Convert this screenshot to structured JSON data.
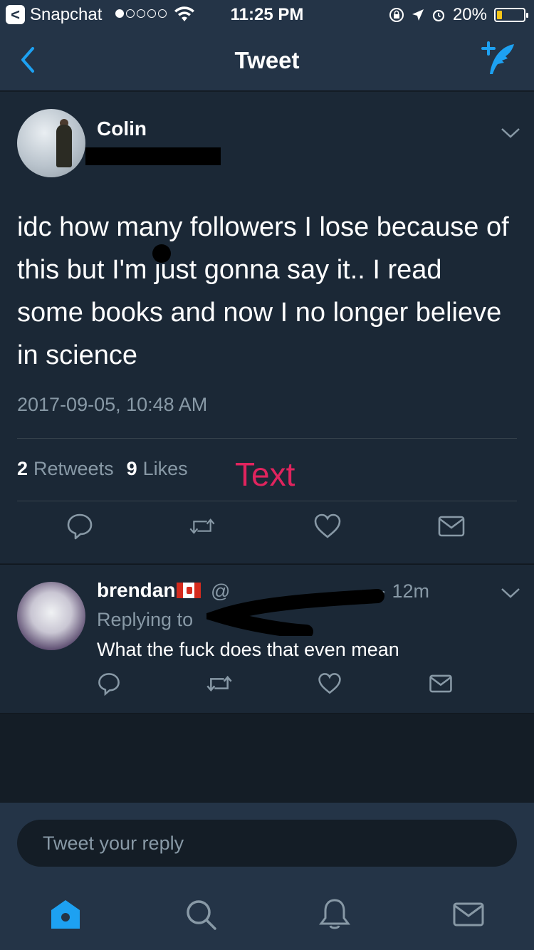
{
  "status_bar": {
    "back_label": "<",
    "app_name": "Snapchat",
    "time": "11:25 PM",
    "battery": "20%",
    "battery_level": 0.2
  },
  "nav": {
    "title": "Tweet"
  },
  "main_tweet": {
    "author_name": "Colin",
    "text": "idc how many followers I lose because of this but I'm just gonna say it.. I read some books and now I no longer believe in science",
    "timestamp": "2017-09-05, 10:48 AM",
    "retweets_count": "2",
    "retweets_label": "Retweets",
    "likes_count": "9",
    "likes_label": "Likes",
    "overlay_text": "Text"
  },
  "reply": {
    "author_name": "brendan",
    "handle": "@",
    "time": "· 12m",
    "replying_to": "Replying to",
    "text": "What the fuck does that even mean"
  },
  "composer": {
    "placeholder": "Tweet your reply"
  },
  "colors": {
    "accent": "#1da1f2",
    "overlay": "#e0245e",
    "background": "#141d26",
    "card": "#1b2836",
    "bar": "#243447"
  },
  "icons": {
    "back": "chevron-left-icon",
    "compose": "compose-tweet-icon",
    "reply": "reply-icon",
    "retweet": "retweet-icon",
    "like": "heart-icon",
    "dm": "envelope-icon",
    "home": "home-icon",
    "search": "search-icon",
    "notifications": "bell-icon",
    "messages": "envelope-icon"
  }
}
